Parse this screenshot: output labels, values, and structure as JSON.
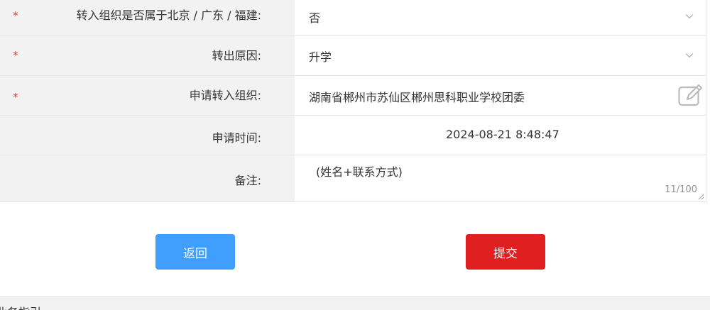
{
  "form": {
    "rows": [
      {
        "label": "转入组织是否属于北京 / 广东 / 福建:",
        "required": true,
        "value": "否",
        "control": "select"
      },
      {
        "label": "转出原因:",
        "required": true,
        "value": "升学",
        "control": "select"
      },
      {
        "label": "申请转入组织:",
        "required": true,
        "value": "湖南省郴州市苏仙区郴州思科职业学校团委",
        "control": "org-picker"
      },
      {
        "label": "申请时间:",
        "required": false,
        "value": "2024-08-21 8:48:47",
        "control": "readonly"
      },
      {
        "label": "备注:",
        "required": false,
        "placeholder": "(姓名+联系方式)",
        "counter": "11/100",
        "control": "textarea"
      }
    ],
    "required_mark": "*"
  },
  "buttons": {
    "back_label": "返回",
    "submit_label": "提交"
  },
  "footer": {
    "text": "业务指引"
  },
  "colors": {
    "required": "#e53935",
    "back_button": "#409eff",
    "submit_button": "#e02020",
    "label_bg": "#f2f2f2"
  },
  "icons": {
    "select_arrow": "chevron-down-icon",
    "org_picker": "edit-icon"
  }
}
